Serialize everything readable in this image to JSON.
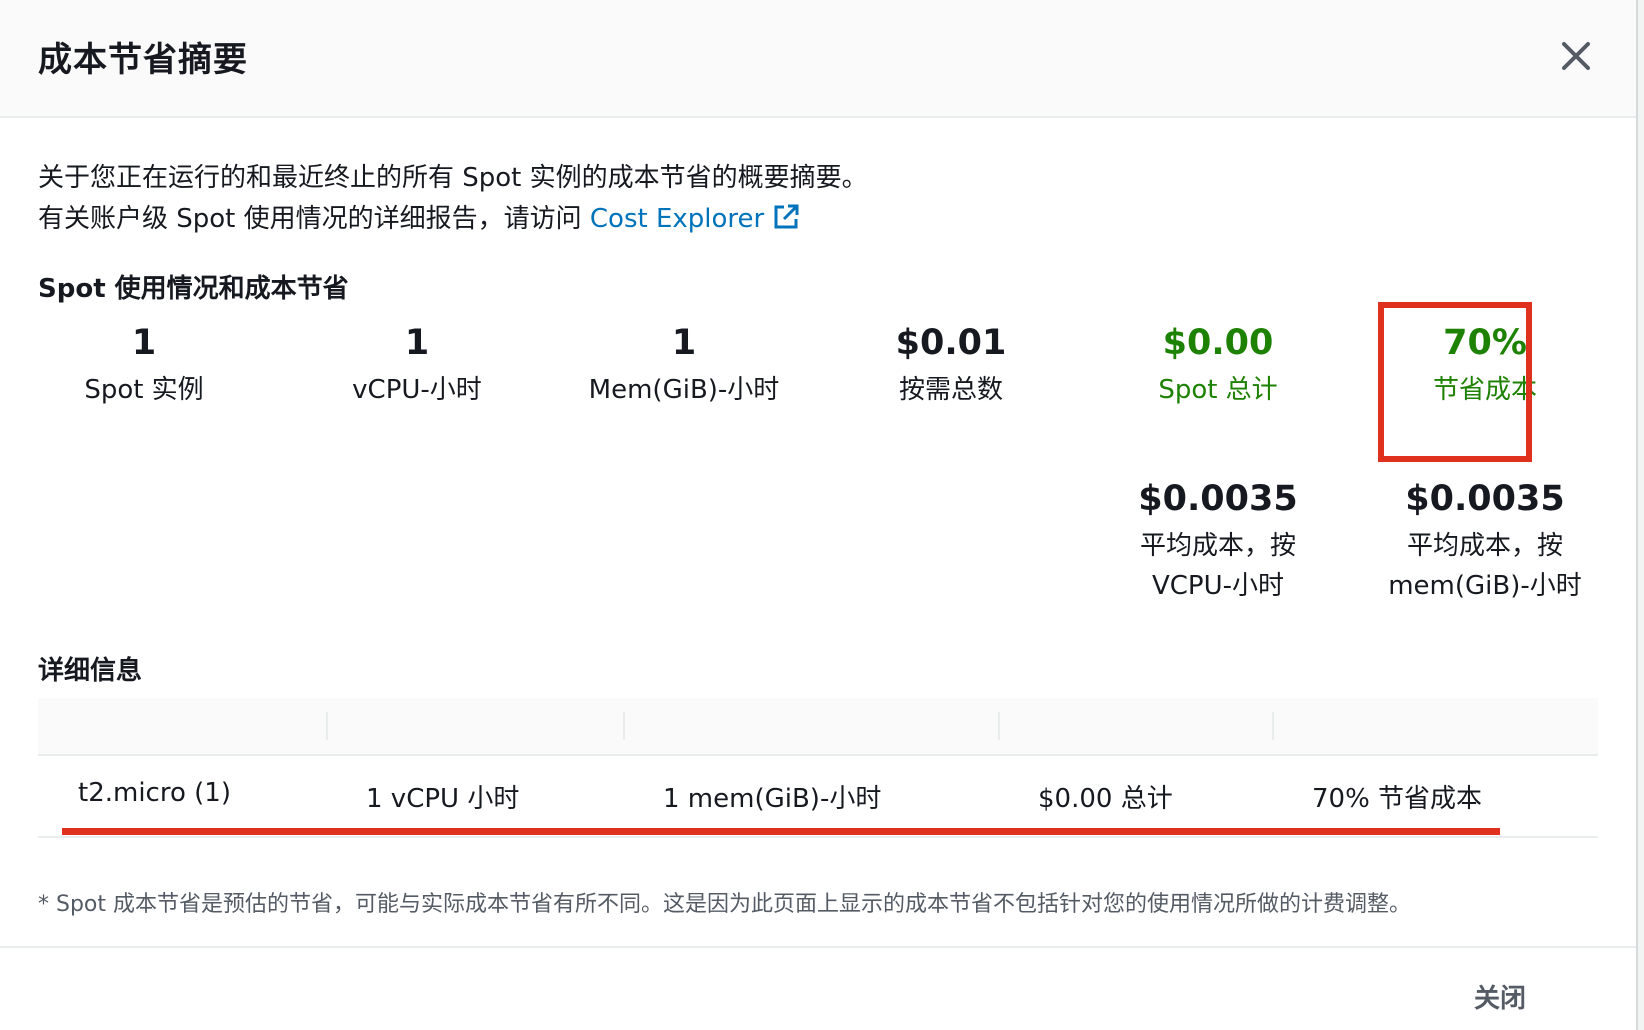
{
  "modal": {
    "title": "成本节省摘要",
    "intro_line1": "关于您正在运行的和最近终止的所有 Spot 实例的成本节省的概要摘要。",
    "intro_line2_prefix": "有关账户级 Spot 使用情况的详细报告，请访问 ",
    "intro_link": "Cost Explorer",
    "usage_section_title": "Spot 使用情况和成本节省",
    "stats": [
      {
        "value": "1",
        "label": "Spot 实例"
      },
      {
        "value": "1",
        "label": "vCPU-小时"
      },
      {
        "value": "1",
        "label": "Mem(GiB)-小时"
      },
      {
        "value": "$0.01",
        "label": "按需总数"
      },
      {
        "value": "$0.00",
        "label": "Spot 总计"
      },
      {
        "value": "70%",
        "label": "节省成本"
      }
    ],
    "avg_stats": [
      {
        "value": "$0.0035",
        "label_line1": "平均成本，按",
        "label_line2": "VCPU-小时"
      },
      {
        "value": "$0.0035",
        "label_line1": "平均成本，按",
        "label_line2": "mem(GiB)-小时"
      }
    ],
    "details_title": "详细信息",
    "details_row": {
      "instance": "t2.micro (1)",
      "vcpu": "1 vCPU 小时",
      "mem": "1 mem(GiB)-小时",
      "total": "$0.00 总计",
      "savings": "70% 节省成本"
    },
    "footnote": "* Spot 成本节省是预估的节省，可能与实际成本节省有所不同。这是因为此页面上显示的成本节省不包括针对您的使用情况所做的计费调整。",
    "close_button": "关闭"
  },
  "colors": {
    "link": "#0073bb",
    "savings_green": "#1d8102",
    "highlight_red": "#e0301e"
  },
  "icons": [
    "close-icon",
    "external-link-icon"
  ]
}
